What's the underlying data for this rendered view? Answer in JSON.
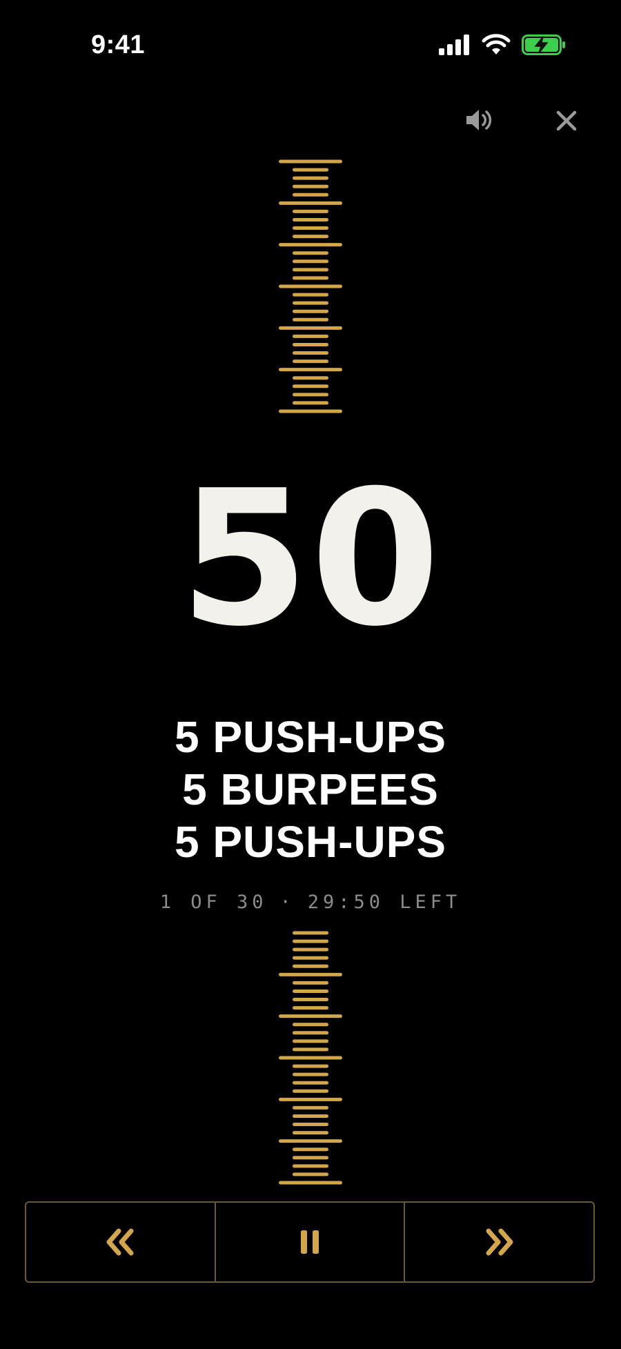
{
  "status_bar": {
    "time": "9:41",
    "icons": [
      "signal-icon",
      "wifi-icon",
      "battery-charging-icon"
    ]
  },
  "controls": {
    "sound_icon": "speaker-icon",
    "close_icon": "close-icon",
    "rewind_icon": "rewind-icon",
    "pause_icon": "pause-icon",
    "forward_icon": "fast-forward-icon"
  },
  "counter": {
    "value": "50"
  },
  "exercises": [
    "5 PUSH-UPS",
    "5 BURPEES",
    "5 PUSH-UPS"
  ],
  "progress": {
    "round": "1 OF 30",
    "separator": "·",
    "time_left": "29:50 LEFT"
  },
  "colors": {
    "accent": "#d4a64a",
    "background": "#000000",
    "text": "#ffffff",
    "muted": "#8c8c8c",
    "battery": "#3ccf4e"
  }
}
